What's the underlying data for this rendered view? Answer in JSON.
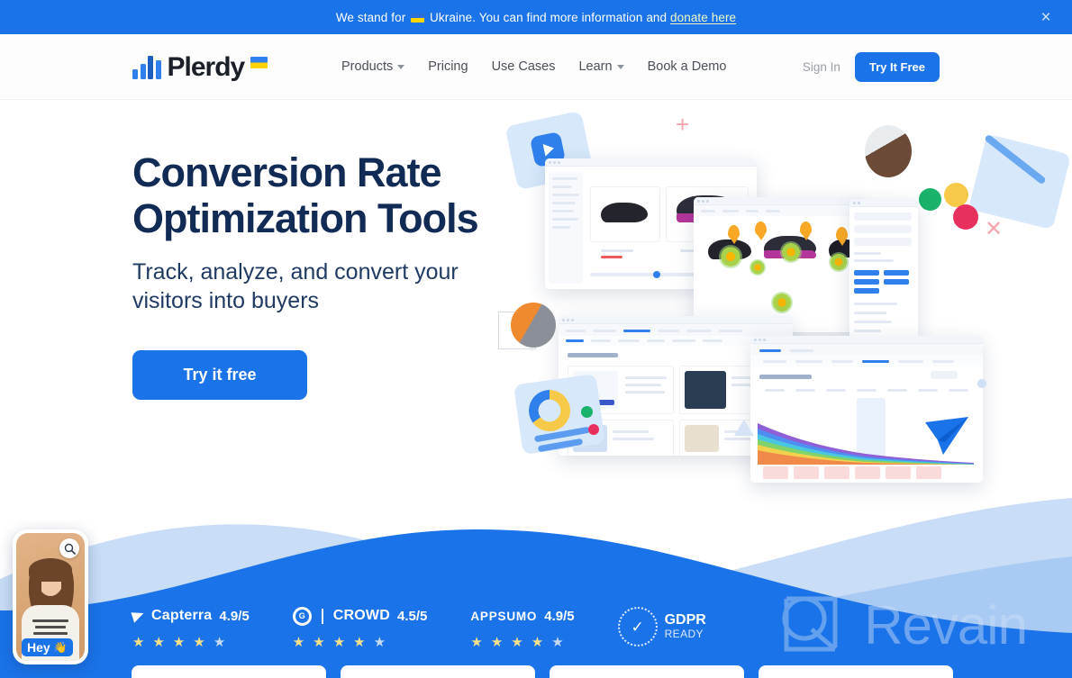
{
  "banner": {
    "text_before_flag": "We stand for",
    "flag_icon": "ukraine-flag-icon",
    "text_after_flag": "Ukraine. You can find more information and",
    "link_label": "donate here",
    "close_icon": "×",
    "background_color": "#1a73e8"
  },
  "header": {
    "logo_text": "Plerdy",
    "logo_flag_icon": "ukraine-flag-icon",
    "nav": [
      {
        "label": "Products",
        "has_dropdown": true
      },
      {
        "label": "Pricing",
        "has_dropdown": false
      },
      {
        "label": "Use Cases",
        "has_dropdown": false
      },
      {
        "label": "Learn",
        "has_dropdown": true
      },
      {
        "label": "Book a Demo",
        "has_dropdown": false
      }
    ],
    "sign_in_label": "Sign In",
    "try_free_label": "Try It Free"
  },
  "hero": {
    "title_line1": "Conversion Rate",
    "title_line2": "Optimization Tools",
    "subtitle_line1": "Track, analyze, and convert your",
    "subtitle_line2": "visitors into buyers",
    "cta_label": "Try it free",
    "title_color": "#122b54",
    "accent_color": "#1a73e8"
  },
  "ratings": [
    {
      "id": "capterra",
      "logo_icon": "capterra-arrow-icon",
      "name": "Capterra",
      "score": "4.9/5",
      "stars_full": 4,
      "stars_half": 1
    },
    {
      "id": "g2crowd",
      "logo_icon": "g2-badge-icon",
      "name": "CROWD",
      "badge_text": "G",
      "badge_sup": "2",
      "score": "4.5/5",
      "stars_full": 4,
      "stars_half": 1
    },
    {
      "id": "appsumo",
      "logo_icon": "appsumo-wordmark-icon",
      "name": "APPSUMO",
      "score": "4.9/5",
      "stars_full": 4,
      "stars_half": 1
    }
  ],
  "gdpr": {
    "icon": "gdpr-check-icon",
    "title": "GDPR",
    "subtitle": "READY"
  },
  "revain": {
    "mark_icon": "revain-logo-icon",
    "label": "Revain"
  },
  "chat_widget": {
    "zoom_icon": "magnifier-icon",
    "greeting": "Hey",
    "wave_icon": "👋"
  },
  "bottom_cards": [
    {
      "id": "card-1"
    },
    {
      "id": "card-2"
    },
    {
      "id": "card-3"
    },
    {
      "id": "card-4"
    }
  ]
}
